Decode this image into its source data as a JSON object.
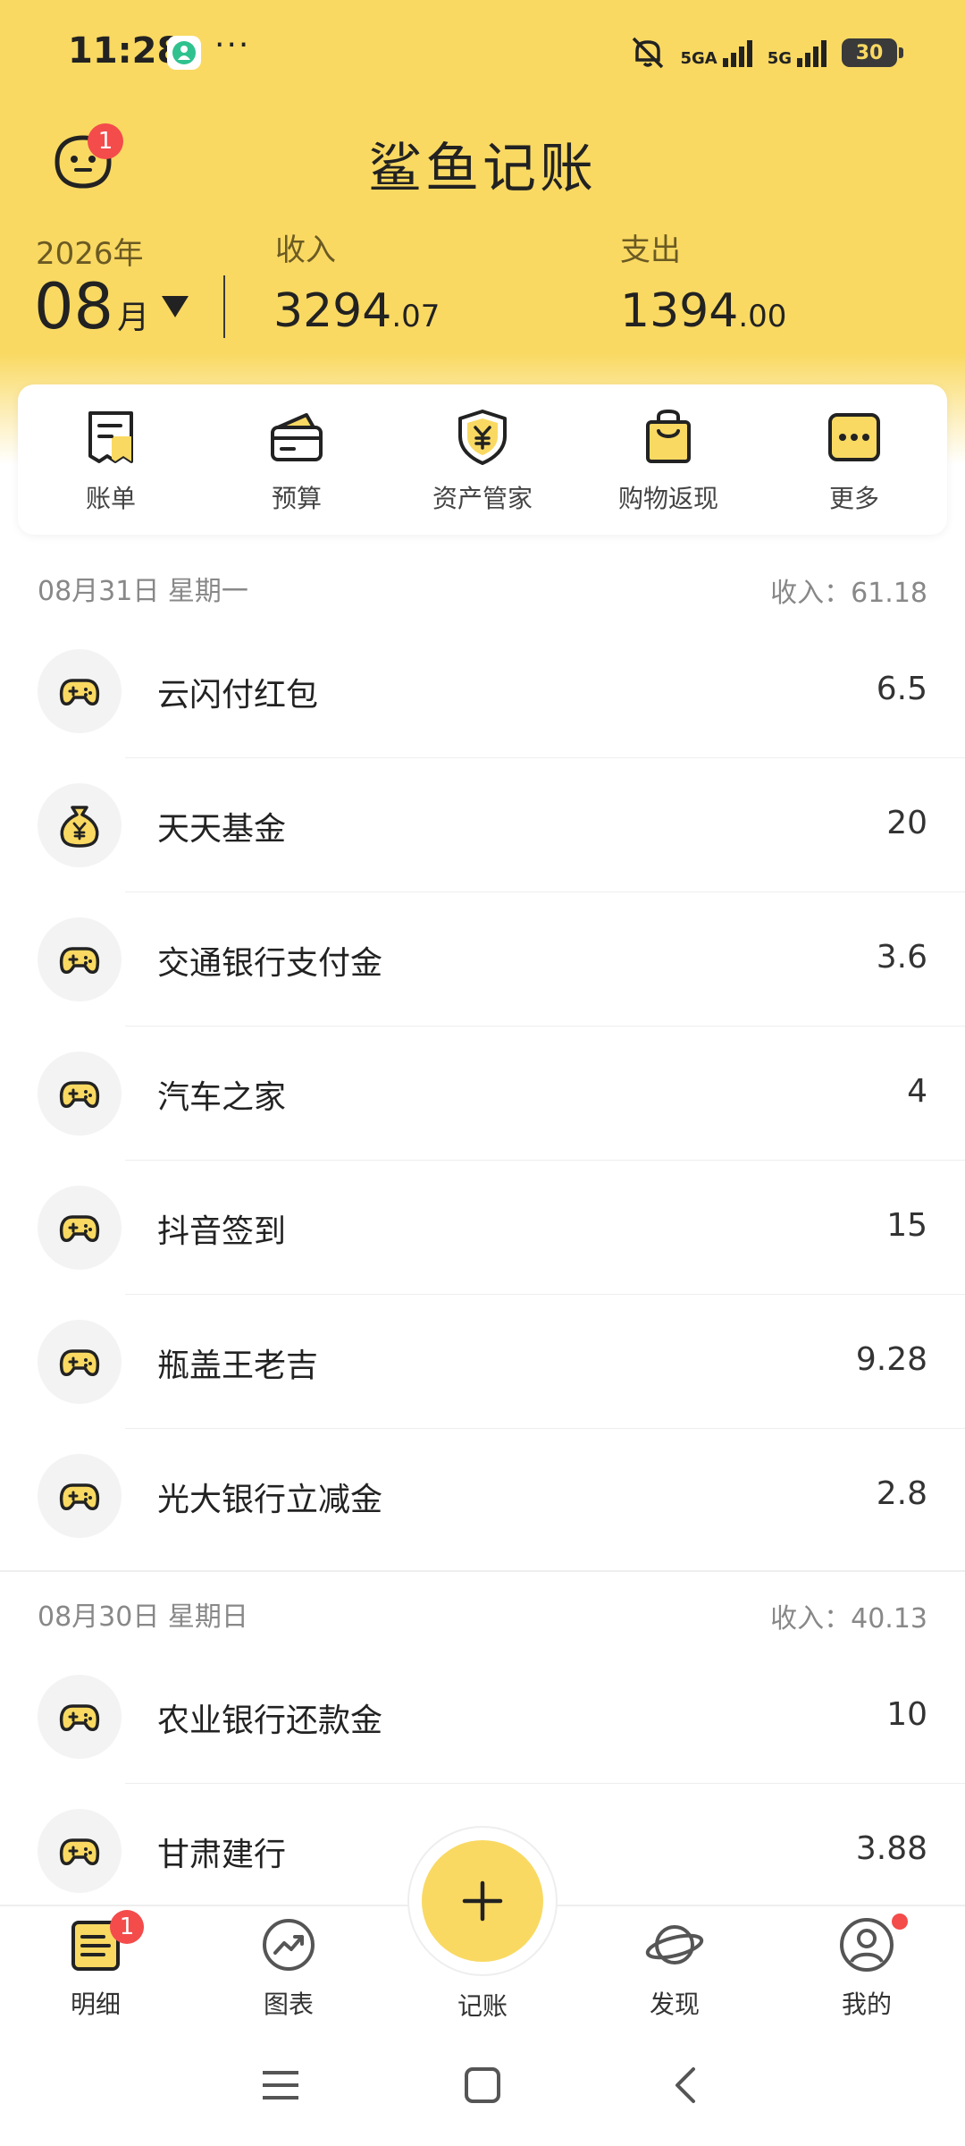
{
  "status_bar": {
    "time": "11:28",
    "dots": "···",
    "net1": "5GA",
    "net2": "5G",
    "battery": "30"
  },
  "header": {
    "title": "鲨鱼记账",
    "avatar_badge": "1"
  },
  "summary": {
    "year": "2026年",
    "month": "08",
    "month_unit": "月",
    "income_label": "收入",
    "income_int": "3294",
    "income_dec": ".07",
    "expense_label": "支出",
    "expense_int": "1394",
    "expense_dec": ".00"
  },
  "shortcuts": [
    {
      "label": "账单",
      "icon": "bill-icon"
    },
    {
      "label": "预算",
      "icon": "wallet-icon"
    },
    {
      "label": "资产管家",
      "icon": "shield-yen-icon"
    },
    {
      "label": "购物返现",
      "icon": "shopping-bag-icon"
    },
    {
      "label": "更多",
      "icon": "more-icon"
    }
  ],
  "days": [
    {
      "date": "08月31日 星期一",
      "total": "收入：61.18",
      "items": [
        {
          "name": "云闪付红包",
          "amount": "6.5",
          "icon": "gamepad-icon"
        },
        {
          "name": "天天基金",
          "amount": "20",
          "icon": "money-bag-icon"
        },
        {
          "name": "交通银行支付金",
          "amount": "3.6",
          "icon": "gamepad-icon"
        },
        {
          "name": "汽车之家",
          "amount": "4",
          "icon": "gamepad-icon"
        },
        {
          "name": "抖音签到",
          "amount": "15",
          "icon": "gamepad-icon"
        },
        {
          "name": "瓶盖王老吉",
          "amount": "9.28",
          "icon": "gamepad-icon"
        },
        {
          "name": "光大银行立减金",
          "amount": "2.8",
          "icon": "gamepad-icon"
        }
      ]
    },
    {
      "date": "08月30日 星期日",
      "total": "收入：40.13",
      "items": [
        {
          "name": "农业银行还款金",
          "amount": "10",
          "icon": "gamepad-icon"
        },
        {
          "name": "甘肃建行",
          "amount": "3.88",
          "icon": "gamepad-icon"
        }
      ]
    }
  ],
  "bottom_nav": {
    "detail": "明细",
    "detail_badge": "1",
    "chart": "图表",
    "add": "记账",
    "discover": "发现",
    "mine": "我的"
  },
  "colors": {
    "brand_yellow": "#f9d962",
    "badge_red": "#f44b4b"
  }
}
